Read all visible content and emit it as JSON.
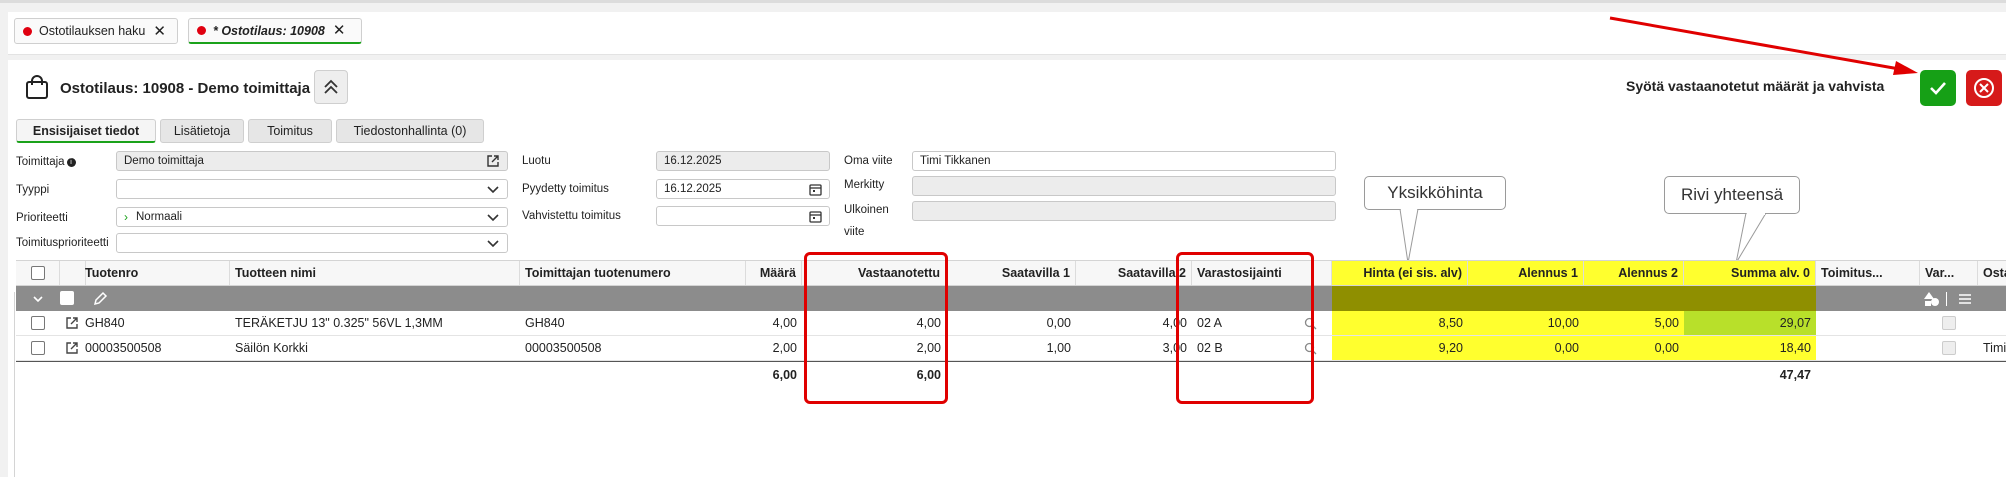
{
  "tabs": [
    {
      "label": "Ostotilauksen haku",
      "active": false
    },
    {
      "label": "* Ostotilaus: 10908",
      "active": true
    }
  ],
  "header": {
    "title": "Ostotilaus: 10908 - Demo toimittaja",
    "instruction": "Syötä vastaanotetut määrät ja vahvista"
  },
  "subtabs": [
    "Ensisijaiset tiedot",
    "Lisätietoja",
    "Toimitus",
    "Tiedostonhallinta (0)"
  ],
  "form": {
    "supplier_label": "Toimittaja",
    "supplier_value": "Demo toimittaja",
    "type_label": "Tyyppi",
    "type_value": "",
    "priority_label": "Prioriteetti",
    "priority_value": "Normaali",
    "delivery_priority_label": "Toimitusprioriteetti",
    "delivery_priority_value": "",
    "created_label": "Luotu",
    "created_value": "16.12.2025",
    "requested_label": "Pyydetty toimitus",
    "requested_value": "16.12.2025",
    "confirmed_label": "Vahvistettu toimitus",
    "confirmed_value": "",
    "own_ref_label": "Oma viite",
    "own_ref_value": "Timi Tikkanen",
    "marked_label": "Merkitty",
    "marked_value": "",
    "external_ref_label_1": "Ulkoinen",
    "external_ref_label_2": "viite",
    "external_ref_value": ""
  },
  "callouts": {
    "unit_price": "Yksikköhinta",
    "row_total": "Rivi yhteensä"
  },
  "table": {
    "columns": [
      "Tuotenro",
      "Tuotteen nimi",
      "Toimittajan tuotenumero",
      "Määrä",
      "Vastaanotettu",
      "Saatavilla 1",
      "Saatavilla 2",
      "Varastosijainti",
      "Hinta (ei sis. alv)",
      "Alennus 1",
      "Alennus 2",
      "Summa alv. 0",
      "Toimitus...",
      "Var...",
      "Osta"
    ],
    "rows": [
      {
        "product_no": "GH840",
        "name": "TERÄKETJU 13\" 0.325\" 56VL 1,3MM",
        "supplier_no": "GH840",
        "qty": "4,00",
        "received": "4,00",
        "avail1": "0,00",
        "avail2": "4,00",
        "location": "02 A",
        "price": "8,50",
        "disc1": "10,00",
        "disc2": "5,00",
        "sum": "29,07",
        "delivery": "",
        "buyer": ""
      },
      {
        "product_no": "00003500508",
        "name": "Säilön Korkki",
        "supplier_no": "00003500508",
        "qty": "2,00",
        "received": "2,00",
        "avail1": "1,00",
        "avail2": "3,00",
        "location": "02 B",
        "price": "9,20",
        "disc1": "0,00",
        "disc2": "0,00",
        "sum": "18,40",
        "delivery": "",
        "buyer": "Timi"
      }
    ],
    "totals": {
      "qty": "6,00",
      "received": "6,00",
      "sum": "47,47"
    }
  },
  "colors": {
    "accent_green": "#1aa21a",
    "confirm_green": "#16a016",
    "cancel_red": "#d61a1a",
    "highlight_yellow": "#ffff2e",
    "annotation_red": "#e00000"
  }
}
